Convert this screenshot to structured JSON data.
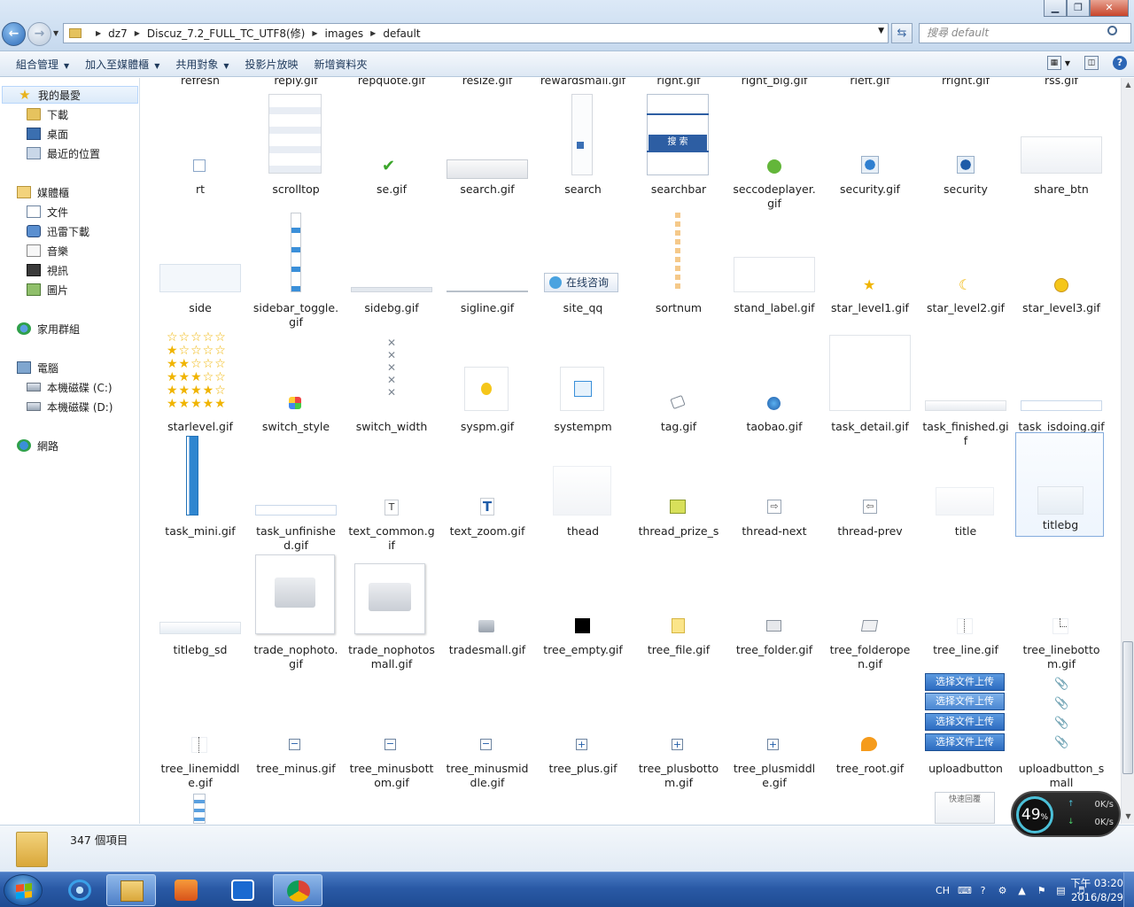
{
  "window": {
    "minimize": "▁",
    "maximize": "❐",
    "close": "✕"
  },
  "address": {
    "crumbs": [
      "dz7",
      "Discuz_7.2_FULL_TC_UTF8(修)",
      "images",
      "default"
    ],
    "search_placeholder": "搜尋 default"
  },
  "toolbar": {
    "organize": "組合管理",
    "include_library": "加入至媒體櫃",
    "share": "共用對象",
    "slideshow": "投影片放映",
    "new_folder": "新增資料夾"
  },
  "nav": {
    "favorites": "我的最愛",
    "downloads": "下載",
    "desktop": "桌面",
    "recent": "最近的位置",
    "libraries": "媒體櫃",
    "documents": "文件",
    "thunder": "迅雷下載",
    "music": "音樂",
    "videos": "視訊",
    "pictures": "圖片",
    "homegroup": "家用群組",
    "computer": "電腦",
    "drive_c": "本機磁碟 (C:)",
    "drive_d": "本機磁碟 (D:)",
    "network": "網路"
  },
  "top_partial_labels": [
    "refresh",
    "reply.gif",
    "repquote.gif",
    "resize.gif",
    "rewardsmall.gif",
    "right.gif",
    "right_big.gif",
    "rleft.gif",
    "rright.gif",
    "rss.gif"
  ],
  "files": [
    [
      "rt",
      "scrolltop",
      "se.gif",
      "search.gif",
      "search",
      "searchbar",
      "seccodeplayer.gif",
      "security.gif",
      "security",
      "share_btn"
    ],
    [
      "side",
      "sidebar_toggle.gif",
      "sidebg.gif",
      "sigline.gif",
      "site_qq",
      "sortnum",
      "stand_label.gif",
      "star_level1.gif",
      "star_level2.gif",
      "star_level3.gif"
    ],
    [
      "starlevel.gif",
      "switch_style",
      "switch_width",
      "syspm.gif",
      "systempm",
      "tag.gif",
      "taobao.gif",
      "task_detail.gif",
      "task_finished.gif",
      "task_isdoing.gif"
    ],
    [
      "task_mini.gif",
      "task_unfinished.gif",
      "text_common.gif",
      "text_zoom.gif",
      "thead",
      "thread_prize_s",
      "thread-next",
      "thread-prev",
      "title",
      "titlebg"
    ],
    [
      "titlebg_sd",
      "trade_nophoto.gif",
      "trade_nophotosmall.gif",
      "tradesmall.gif",
      "tree_empty.gif",
      "tree_file.gif",
      "tree_folder.gif",
      "tree_folderopen.gif",
      "tree_line.gif",
      "tree_linebottom.gif"
    ],
    [
      "tree_linemiddle.gif",
      "tree_minus.gif",
      "tree_minusbottom.gif",
      "tree_minusmiddle.gif",
      "tree_plus.gif",
      "tree_plusbottom.gif",
      "tree_plusmiddle.gif",
      "tree_root.gif",
      "uploadbutton",
      "uploadbutton_small"
    ]
  ],
  "thumb_text": {
    "searchbar_btn": "搜 索",
    "site_qq": "在线咨询",
    "upload_btn": "选择文件上传",
    "quick_reply": "快速回覆"
  },
  "status": {
    "item_count": "347 個項目"
  },
  "net_widget": {
    "percent": "49",
    "unit": "%",
    "up": "0K/s",
    "down": "0K/s"
  },
  "tray": {
    "lang": "CH",
    "time": "下午 03:20",
    "date": "2016/8/29"
  }
}
